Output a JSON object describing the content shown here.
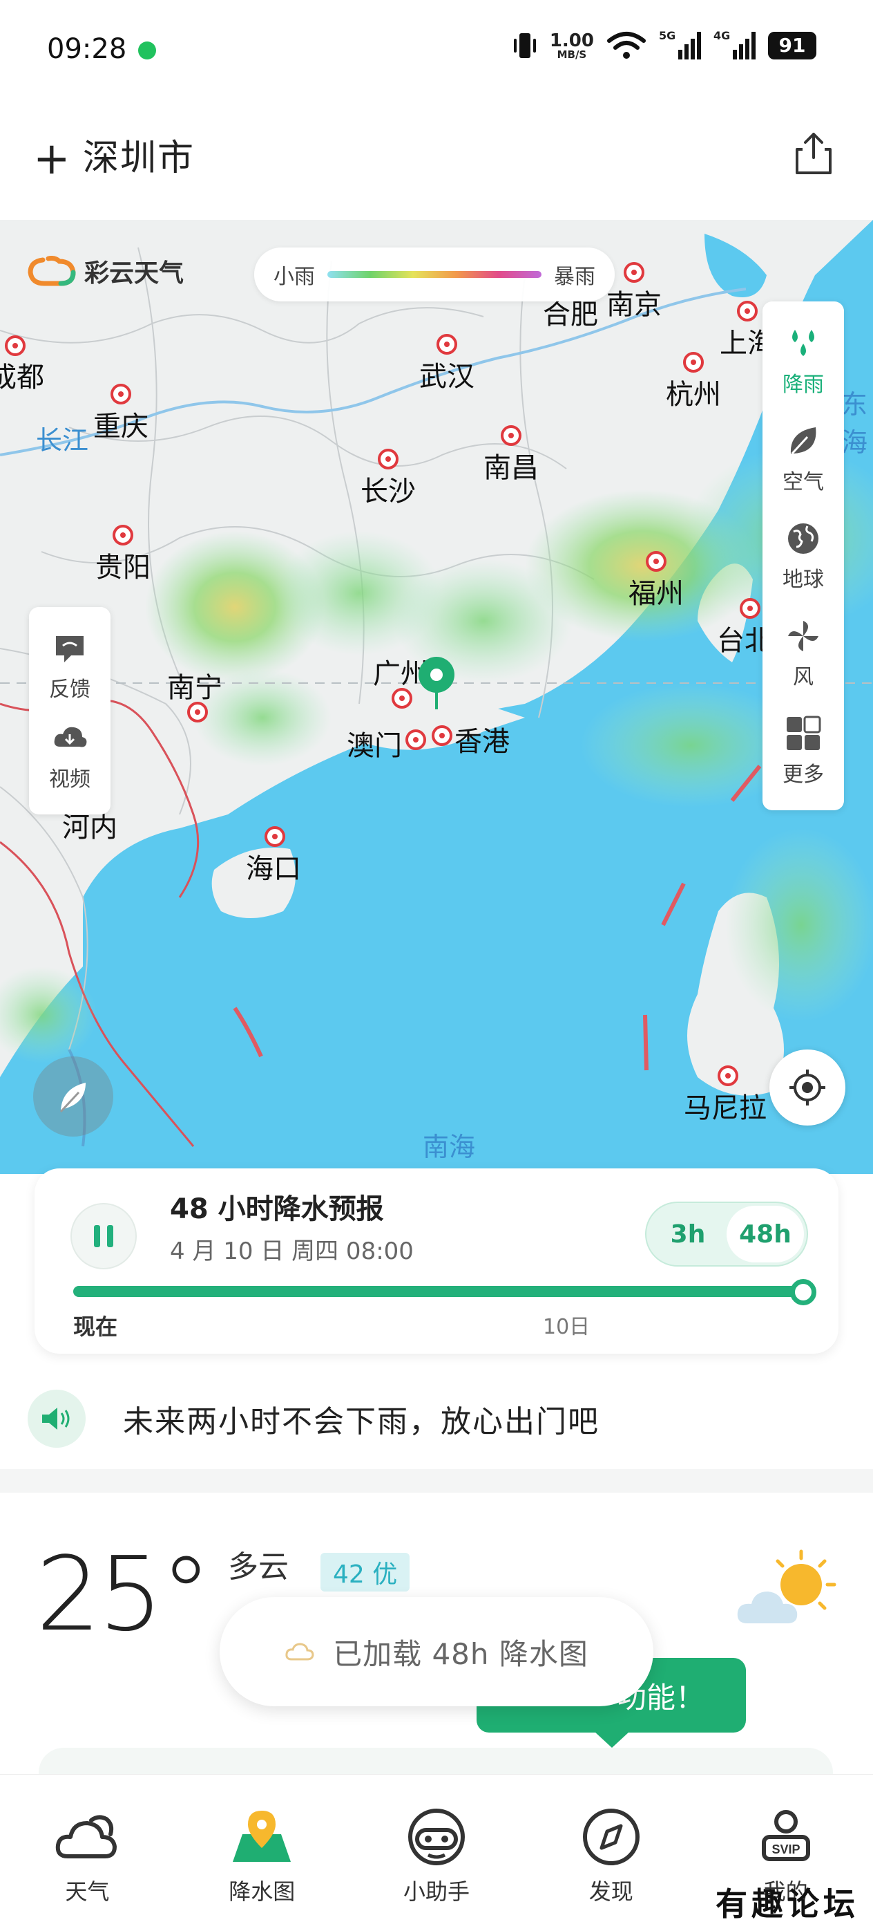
{
  "status_bar": {
    "time": "09:28",
    "net_speed_value": "1.00",
    "net_speed_unit": "MB/S",
    "signal_1_label": "5G",
    "signal_2_label": "4G",
    "battery": "91",
    "icons": [
      "notification-dot-icon",
      "vibrate-icon",
      "wifi-icon",
      "signal-icon",
      "battery-icon"
    ]
  },
  "header": {
    "add_icon": "+",
    "city": "深圳市",
    "share_icon": "share-icon"
  },
  "map": {
    "brand": "彩云天气",
    "legend": {
      "min": "小雨",
      "max": "暴雨"
    },
    "cities": [
      {
        "id": "chengdu",
        "name": "成都"
      },
      {
        "id": "chongqing",
        "name": "重庆"
      },
      {
        "id": "wuhan",
        "name": "武汉"
      },
      {
        "id": "hefei",
        "name": "合肥"
      },
      {
        "id": "nanjing",
        "name": "南京"
      },
      {
        "id": "shanghai",
        "name": "上海"
      },
      {
        "id": "hangzhou",
        "name": "杭州"
      },
      {
        "id": "changsha",
        "name": "长沙"
      },
      {
        "id": "nanchang",
        "name": "南昌"
      },
      {
        "id": "guiyang",
        "name": "贵阳"
      },
      {
        "id": "fuzhou",
        "name": "福州"
      },
      {
        "id": "taibei",
        "name": "台北"
      },
      {
        "id": "nanning",
        "name": "南宁"
      },
      {
        "id": "guangzhou",
        "name": "广州"
      },
      {
        "id": "aomen",
        "name": "澳门"
      },
      {
        "id": "xianggang",
        "name": "香港"
      },
      {
        "id": "henei",
        "name": "河内"
      },
      {
        "id": "haikou",
        "name": "海口"
      },
      {
        "id": "manila",
        "name": "马尼拉"
      }
    ],
    "water_labels": {
      "changjiang": "长江",
      "donghai": "东海",
      "nanhai": "南海"
    },
    "left_panel": [
      {
        "label": "反馈",
        "icon": "feedback-icon"
      },
      {
        "label": "视频",
        "icon": "video-download-icon"
      }
    ],
    "right_panel": [
      {
        "label": "降雨",
        "icon": "rain-icon",
        "active": true
      },
      {
        "label": "空气",
        "icon": "leaf-icon"
      },
      {
        "label": "地球",
        "icon": "globe-icon"
      },
      {
        "label": "风",
        "icon": "pinwheel-icon"
      },
      {
        "label": "更多",
        "icon": "grid-icon"
      }
    ]
  },
  "forecast": {
    "title": "48 小时降水预报",
    "datetime": "4 月 10 日 周四 08:00",
    "seg_3h": "3h",
    "seg_48h": "48h",
    "selected": "48h",
    "progress_fraction": 1.0,
    "label_now": "现在",
    "label_day": "10日"
  },
  "tip": {
    "text": "未来两小时不会下雨，放心出门吧"
  },
  "current": {
    "temperature": "25°",
    "condition": "多云",
    "aqi": "42 优"
  },
  "toast": {
    "text": "已加载 48h 降水图"
  },
  "promo": {
    "text": "功能！"
  },
  "bottom_nav": [
    {
      "label": "天气",
      "icon": "cloud-icon"
    },
    {
      "label": "降水图",
      "icon": "map-pin-icon",
      "active": true
    },
    {
      "label": "小助手",
      "icon": "assistant-icon"
    },
    {
      "label": "发现",
      "icon": "compass-icon"
    },
    {
      "label": "我的",
      "icon": "svip-user-icon"
    }
  ],
  "watermark": "有趣论坛",
  "colors": {
    "accent": "#1fae72",
    "marker": "#e0393e",
    "sea": "#5cc9ef",
    "land": "#eef0f0"
  }
}
